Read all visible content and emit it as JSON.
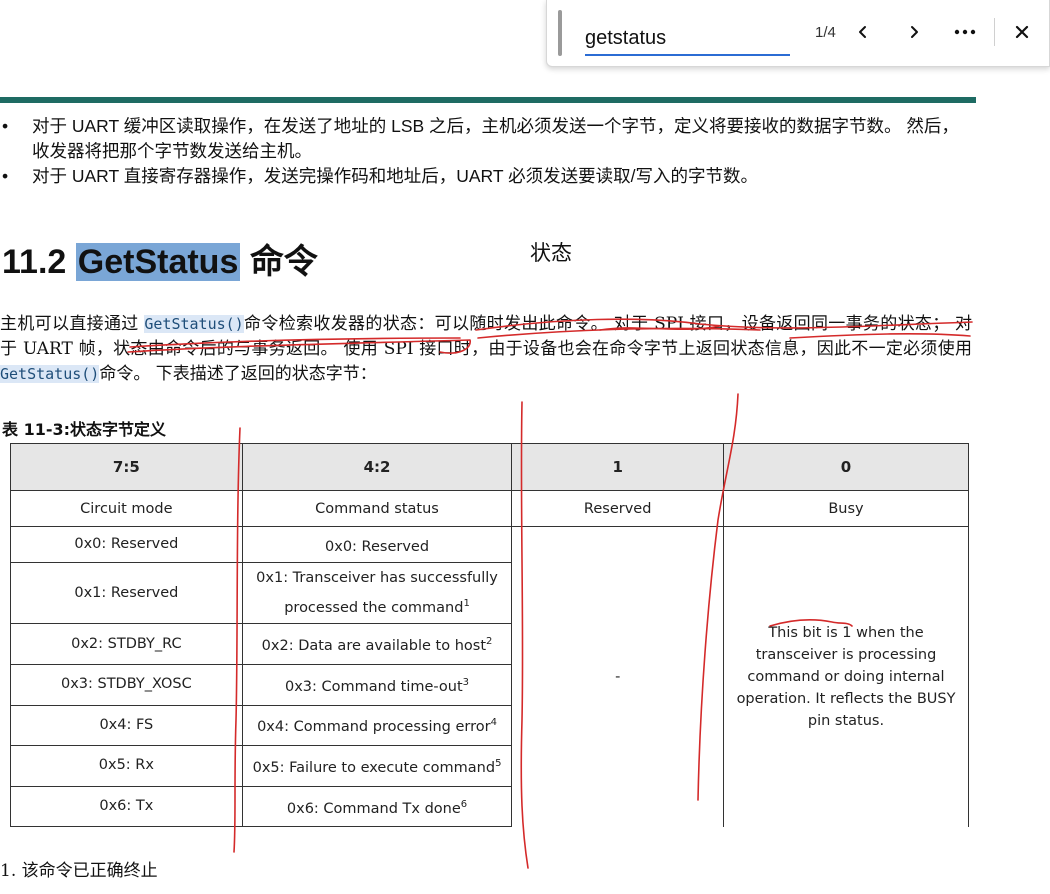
{
  "find_bar": {
    "query": "getstatus",
    "match_count": "1/4",
    "icons": {
      "previous": "chevron-left-icon",
      "next": "chevron-right-icon",
      "more": "more-options-icon",
      "close": "close-icon"
    }
  },
  "bullets": [
    "对于 UART 缓冲区读取操作，在发送了地址的 LSB 之后，主机必须发送一个字节，定义将要接收的数据字节数。 然后，收发器将把那个字节数发送给主机。",
    "对于 UART 直接寄存器操作，发送完操作码和地址后，UART 必须发送要读取/写入的字节数。"
  ],
  "bullet_marker": "•",
  "heading": {
    "number": "11.2",
    "highlighted": "GetStatus",
    "rest": "命令"
  },
  "handwritten_annotation": "状态",
  "paragraph": {
    "part1": "主机可以直接通过 ",
    "code1": "GetStatus()",
    "part2": "命令检索收发器的状态：可以随时发出此命令。 对于 SPI 接口，设备返回同一事务的状态； 对于 UART 帧，状态由命令后的与事务返回。 使用 SPI 接口时，由于设备也会在命令字节上返回状态信息，因此不一定必须使用 ",
    "code2": "GetStatus()",
    "part3": "命令。 下表描述了返回的状态字节："
  },
  "table_caption": "表 11-3:状态字节定义",
  "table": {
    "headers": [
      "7:5",
      "4:2",
      "1",
      "0"
    ],
    "subheaders": [
      "Circuit mode",
      "Command status",
      "Reserved",
      "Busy"
    ],
    "rows": [
      {
        "mode": "0x0: Reserved",
        "status": "0x0: Reserved",
        "sup": ""
      },
      {
        "mode": "0x1: Reserved",
        "status": "0x1: Transceiver has successfully processed the command",
        "sup": "1"
      },
      {
        "mode": "0x2: STDBY_RC",
        "status": "0x2: Data are available to host",
        "sup": "2"
      },
      {
        "mode": "0x3: STDBY_XOSC",
        "status": "0x3: Command time-out",
        "sup": "3"
      },
      {
        "mode": "0x4: FS",
        "status": "0x4: Command processing error",
        "sup": "4"
      },
      {
        "mode": "0x5: Rx",
        "status": "0x5: Failure to execute command",
        "sup": "5"
      },
      {
        "mode": "0x6: Tx",
        "status": "0x6: Command Tx done",
        "sup": "6"
      }
    ],
    "reserved_value": "-",
    "busy_description": "This bit is 1 when the transceiver is processing command or doing internal operation. It reflects the BUSY pin status."
  },
  "footnote": "1. 该命令已正确终止",
  "colors": {
    "teal_rule": "#1e6b63",
    "heading_highlight": "#7aa6d6",
    "code_highlight": "#dbe7f6",
    "ink_red": "#d42a2a",
    "find_underline": "#2b6cd4"
  }
}
